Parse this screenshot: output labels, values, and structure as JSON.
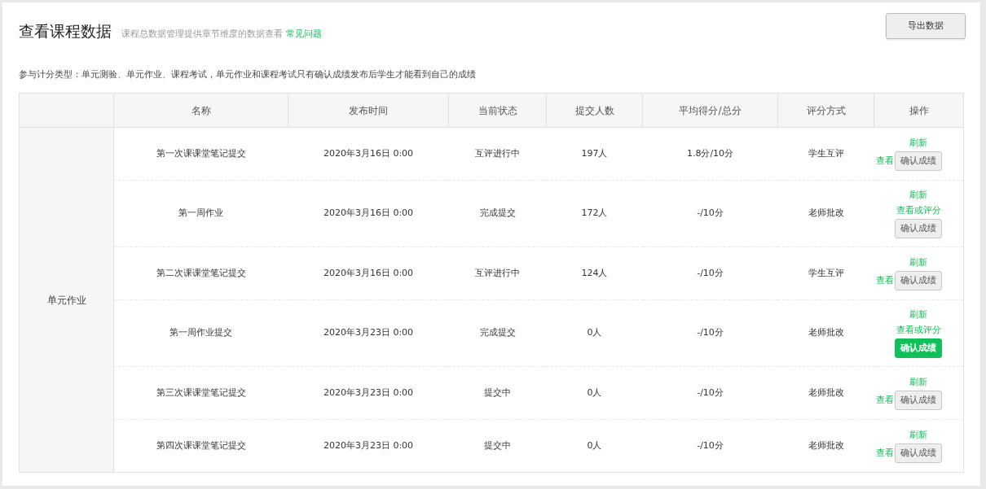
{
  "header": {
    "title": "查看课程数据",
    "subtitle": "课程总数据管理提供章节维度的数据查看",
    "help_link": "常见问题",
    "export_button": "导出数据"
  },
  "note": "参与计分类型：单元测验、单元作业、课程考试，单元作业和课程考试只有确认成绩发布后学生才能看到自己的成绩",
  "table": {
    "columns": [
      "名称",
      "发布时间",
      "当前状态",
      "提交人数",
      "平均得分/总分",
      "评分方式",
      "操作"
    ],
    "group": "单元作业",
    "rows": [
      {
        "name": "第一次课课堂笔记提交",
        "time": "2020年3月16日 0:00",
        "status": "互评进行中",
        "count": "197人",
        "score": "1.8分/10分",
        "method": "学生互评",
        "refresh": "刷新",
        "view": "查看",
        "kind": "inline",
        "confirm": "确认成绩",
        "highlighted": false
      },
      {
        "name": "第一周作业",
        "time": "2020年3月16日 0:00",
        "status": "完成提交",
        "count": "172人",
        "score": "-/10分",
        "method": "老师批改",
        "refresh": "刷新",
        "view": "查看或评分",
        "kind": "stacked",
        "confirm": "确认成绩",
        "highlighted": false
      },
      {
        "name": "第二次课课堂笔记提交",
        "time": "2020年3月16日 0:00",
        "status": "互评进行中",
        "count": "124人",
        "score": "-/10分",
        "method": "学生互评",
        "refresh": "刷新",
        "view": "查看",
        "kind": "inline",
        "confirm": "确认成绩",
        "highlighted": false
      },
      {
        "name": "第一周作业提交",
        "time": "2020年3月23日 0:00",
        "status": "完成提交",
        "count": "0人",
        "score": "-/10分",
        "method": "老师批改",
        "refresh": "刷新",
        "view": "查看或评分",
        "kind": "stacked",
        "confirm": "确认成绩",
        "highlighted": true
      },
      {
        "name": "第三次课课堂笔记提交",
        "time": "2020年3月23日 0:00",
        "status": "提交中",
        "count": "0人",
        "score": "-/10分",
        "method": "老师批改",
        "refresh": "刷新",
        "view": "查看",
        "kind": "inline",
        "confirm": "确认成绩",
        "highlighted": false
      },
      {
        "name": "第四次课课堂笔记提交",
        "time": "2020年3月23日 0:00",
        "status": "提交中",
        "count": "0人",
        "score": "-/10分",
        "method": "老师批改",
        "refresh": "刷新",
        "view": "查看",
        "kind": "inline",
        "confirm": "确认成绩",
        "highlighted": false
      }
    ]
  }
}
